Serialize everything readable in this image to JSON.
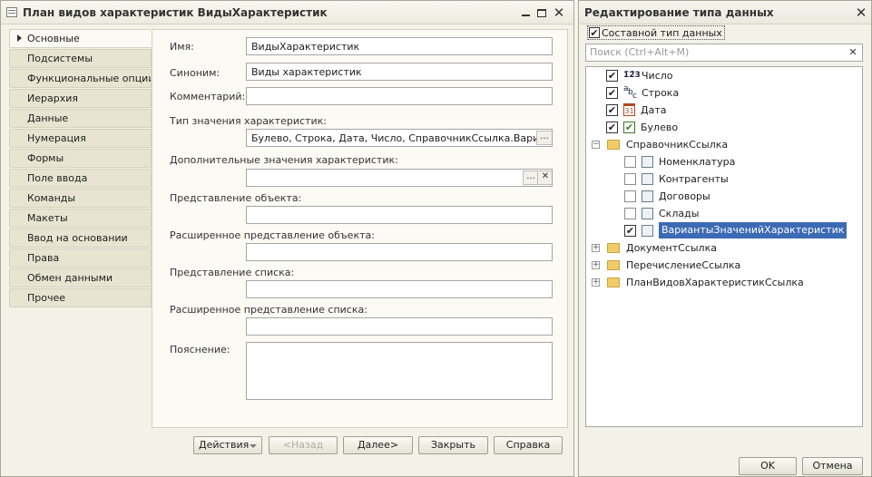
{
  "left_window": {
    "title": "План видов характеристик ВидыХарактеристик",
    "tabs": [
      "Основные",
      "Подсистемы",
      "Функциональные опции",
      "Иерархия",
      "Данные",
      "Нумерация",
      "Формы",
      "Поле ввода",
      "Команды",
      "Макеты",
      "Ввод на основании",
      "Права",
      "Обмен данными",
      "Прочее"
    ],
    "fields": {
      "name_label": "Имя:",
      "name_value": "ВидыХарактеристик",
      "synonym_label": "Синоним:",
      "synonym_value": "Виды характеристик",
      "comment_label": "Комментарий:",
      "comment_value": "",
      "value_type_label": "Тип значения характеристик:",
      "value_type_value": "Булево, Строка, Дата, Число, СправочникСсылка.ВариантыЗн",
      "additional_values_label": "Дополнительные значения характеристик:",
      "additional_values_value": "",
      "object_presentation_label": "Представление объекта:",
      "ext_object_presentation_label": "Расширенное представление объекта:",
      "list_presentation_label": "Представление списка:",
      "ext_list_presentation_label": "Расширенное представление списка:",
      "explanation_label": "Пояснение:"
    },
    "buttons": {
      "actions": "Действия",
      "back": "<Назад",
      "next": "Далее>",
      "close": "Закрыть",
      "help": "Справка"
    },
    "field_buttons": {
      "ellipsis": "...",
      "clear": "✕"
    }
  },
  "right_window": {
    "title": "Редактирование типа данных",
    "composite_label": "Составной тип данных",
    "composite_checked": true,
    "search_placeholder": "Поиск (Ctrl+Alt+M)",
    "tree": [
      {
        "label": "Число",
        "checked": true,
        "icon": "number-icon"
      },
      {
        "label": "Строка",
        "checked": true,
        "icon": "string-icon"
      },
      {
        "label": "Дата",
        "checked": true,
        "icon": "date-icon"
      },
      {
        "label": "Булево",
        "checked": true,
        "icon": "boolean-icon"
      },
      {
        "label": "СправочникСсылка",
        "expanded": true,
        "icon": "folder-icon"
      },
      {
        "label": "Номенклатура",
        "checked": false,
        "icon": "catalog-icon"
      },
      {
        "label": "Контрагенты",
        "checked": false,
        "icon": "catalog-icon"
      },
      {
        "label": "Договоры",
        "checked": false,
        "icon": "catalog-icon"
      },
      {
        "label": "Склады",
        "checked": false,
        "icon": "catalog-icon"
      },
      {
        "label": "ВариантыЗначенийХарактеристик",
        "checked": true,
        "selected": true,
        "icon": "catalog-icon"
      },
      {
        "label": "ДокументСсылка",
        "expanded": false,
        "icon": "folder-icon"
      },
      {
        "label": "ПеречислениеСсылка",
        "expanded": false,
        "icon": "folder-icon"
      },
      {
        "label": "ПланВидовХарактеристикСсылка",
        "expanded": false,
        "icon": "folder-icon"
      }
    ],
    "icon_text": {
      "number": "1̄2̄3",
      "string_a": "a",
      "string_b": "b",
      "string_c": "c",
      "date": "31"
    },
    "expander_collapsed": "+",
    "expander_expanded": "−",
    "buttons": {
      "ok": "OK",
      "cancel": "Отмена"
    }
  },
  "colors": {
    "selection": "#3d6ab4",
    "tab_bg": "#e7e5d1",
    "panel_bg": "#fbfaf4"
  }
}
